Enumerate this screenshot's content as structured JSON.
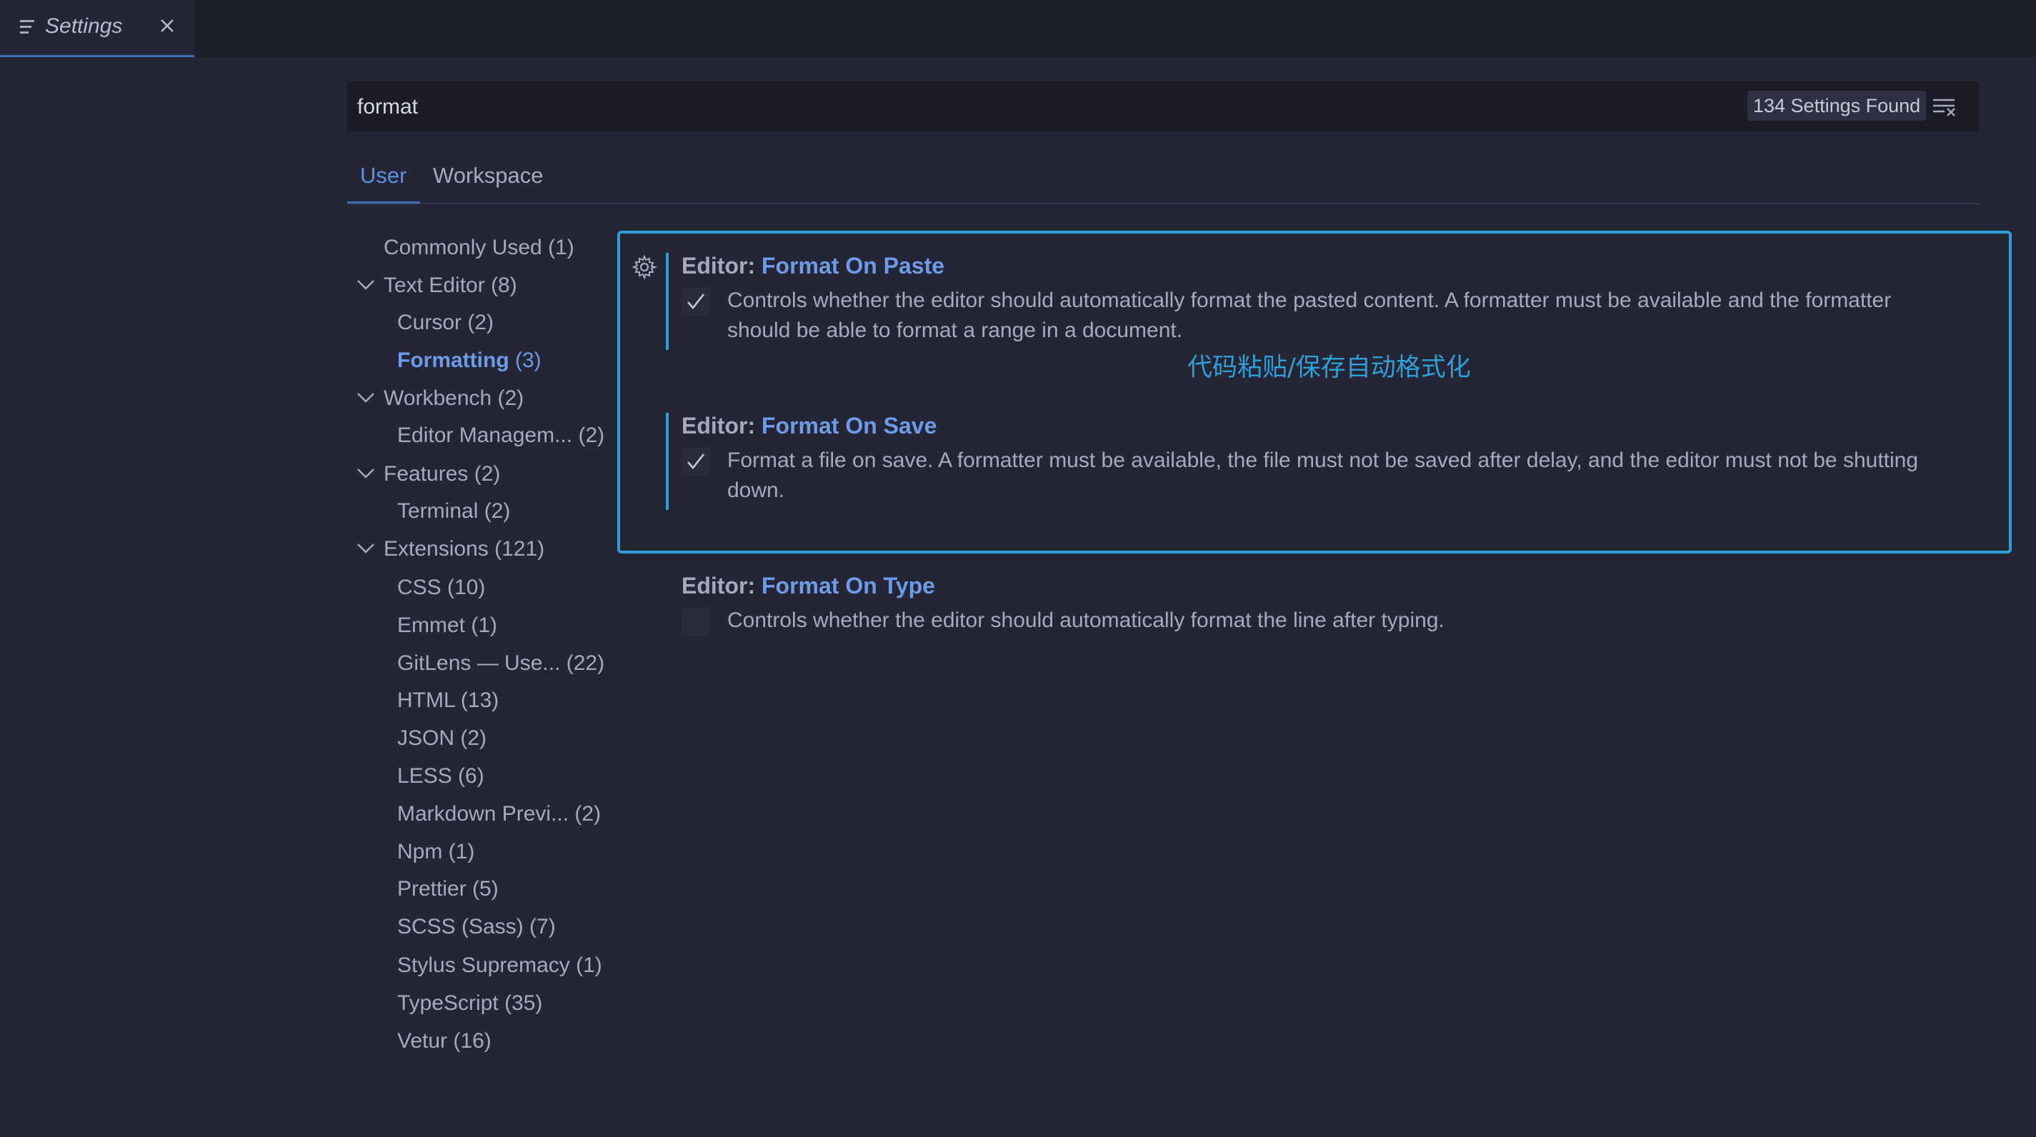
{
  "tab": {
    "title": "Settings"
  },
  "search": {
    "value": "format",
    "results_badge": "134 Settings Found"
  },
  "scope_tabs": {
    "user": "User",
    "workspace": "Workspace"
  },
  "toc": [
    {
      "label": "Commonly Used",
      "count": " (1)"
    },
    {
      "label": "Text Editor",
      "count": " (8)",
      "expanded": true
    },
    {
      "label": "Cursor",
      "count": " (2)"
    },
    {
      "label": "Formatting",
      "count": " (3)",
      "active": true
    },
    {
      "label": "Workbench",
      "count": " (2)",
      "expanded": true
    },
    {
      "label": "Editor Managem...",
      "count": " (2)"
    },
    {
      "label": "Features",
      "count": " (2)",
      "expanded": true
    },
    {
      "label": "Terminal",
      "count": " (2)"
    },
    {
      "label": "Extensions",
      "count": " (121)",
      "expanded": true
    },
    {
      "label": "CSS",
      "count": " (10)"
    },
    {
      "label": "Emmet",
      "count": " (1)"
    },
    {
      "label": "GitLens — Use...",
      "count": " (22)"
    },
    {
      "label": "HTML",
      "count": " (13)"
    },
    {
      "label": "JSON",
      "count": " (2)"
    },
    {
      "label": "LESS",
      "count": " (6)"
    },
    {
      "label": "Markdown Previ...",
      "count": " (2)"
    },
    {
      "label": "Npm",
      "count": " (1)"
    },
    {
      "label": "Prettier",
      "count": " (5)"
    },
    {
      "label": "SCSS (Sass)",
      "count": " (7)"
    },
    {
      "label": "Stylus Supremacy",
      "count": " (1)"
    },
    {
      "label": "TypeScript",
      "count": " (35)"
    },
    {
      "label": "Vetur",
      "count": " (16)"
    }
  ],
  "settings": [
    {
      "category": "Editor: ",
      "name": "Format On Paste",
      "checked": true,
      "description": "Controls whether the editor should automatically format the pasted content. A formatter must be available and the formatter should be able to format a range in a document."
    },
    {
      "category": "Editor: ",
      "name": "Format On Save",
      "checked": true,
      "description": "Format a file on save. A formatter must be available, the file must not be saved after delay, and the editor must not be shutting down."
    },
    {
      "category": "Editor: ",
      "name": "Format On Type",
      "checked": false,
      "description": "Controls whether the editor should automatically format the line after typing."
    }
  ],
  "annotation": "代码粘贴/保存自动格式化",
  "colors": {
    "accent": "#6d9be8",
    "highlight": "#2f9fd8",
    "background": "#242636"
  }
}
